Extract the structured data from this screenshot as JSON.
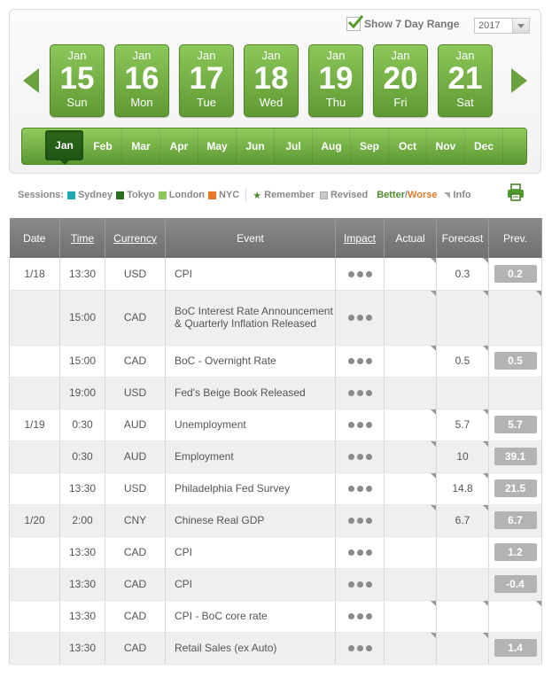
{
  "header": {
    "range_checkbox_label": "Show 7 Day Range",
    "year_value": "2017",
    "days": [
      {
        "month": "Jan",
        "day": "15",
        "weekday": "Sun"
      },
      {
        "month": "Jan",
        "day": "16",
        "weekday": "Mon"
      },
      {
        "month": "Jan",
        "day": "17",
        "weekday": "Tue"
      },
      {
        "month": "Jan",
        "day": "18",
        "weekday": "Wed"
      },
      {
        "month": "Jan",
        "day": "19",
        "weekday": "Thu"
      },
      {
        "month": "Jan",
        "day": "20",
        "weekday": "Fri"
      },
      {
        "month": "Jan",
        "day": "21",
        "weekday": "Sat"
      }
    ],
    "months": [
      "Jan",
      "Feb",
      "Mar",
      "Apr",
      "May",
      "Jun",
      "Jul",
      "Aug",
      "Sep",
      "Oct",
      "Nov",
      "Dec"
    ],
    "active_month": "Jan"
  },
  "legend": {
    "sessions_label": "Sessions:",
    "sessions": [
      {
        "name": "Sydney",
        "color": "#1fa9b0"
      },
      {
        "name": "Tokyo",
        "color": "#2b6e1d"
      },
      {
        "name": "London",
        "color": "#8cc75a"
      },
      {
        "name": "NYC",
        "color": "#e8772a"
      }
    ],
    "remember": "Remember",
    "revised": "Revised",
    "better": "Better",
    "slash": " / ",
    "worse": "Worse",
    "info": "Info"
  },
  "table": {
    "headers": {
      "date": "Date",
      "time": "Time",
      "currency": "Currency",
      "event": "Event",
      "impact": "Impact",
      "actual": "Actual",
      "forecast": "Forecast",
      "prev": "Prev."
    },
    "rows": [
      {
        "date": "1/18",
        "time": "13:30",
        "currency": "USD",
        "event": "CPI",
        "actual": "",
        "forecast": "0.3",
        "prev": "0.2"
      },
      {
        "date": "",
        "time": "15:00",
        "currency": "CAD",
        "event": "BoC Interest Rate Announcement & Quarterly Inflation Released",
        "actual": "",
        "forecast": "",
        "prev": ""
      },
      {
        "date": "",
        "time": "15:00",
        "currency": "CAD",
        "event": "BoC - Overnight Rate",
        "actual": "",
        "forecast": "0.5",
        "prev": "0.5"
      },
      {
        "date": "",
        "time": "19:00",
        "currency": "USD",
        "event": "Fed's Beige Book Released",
        "actual": "",
        "forecast": "",
        "prev": ""
      },
      {
        "date": "1/19",
        "time": "0:30",
        "currency": "AUD",
        "event": "Unemployment",
        "actual": "",
        "forecast": "5.7",
        "prev": "5.7"
      },
      {
        "date": "",
        "time": "0:30",
        "currency": "AUD",
        "event": "Employment",
        "actual": "",
        "forecast": "10",
        "prev": "39.1"
      },
      {
        "date": "",
        "time": "13:30",
        "currency": "USD",
        "event": "Philadelphia Fed Survey",
        "actual": "",
        "forecast": "14.8",
        "prev": "21.5"
      },
      {
        "date": "1/20",
        "time": "2:00",
        "currency": "CNY",
        "event": "Chinese Real GDP",
        "actual": "",
        "forecast": "6.7",
        "prev": "6.7"
      },
      {
        "date": "",
        "time": "13:30",
        "currency": "CAD",
        "event": "CPI",
        "actual": "",
        "forecast": "",
        "prev": "1.2"
      },
      {
        "date": "",
        "time": "13:30",
        "currency": "CAD",
        "event": "CPI",
        "actual": "",
        "forecast": "",
        "prev": "-0.4"
      },
      {
        "date": "",
        "time": "13:30",
        "currency": "CAD",
        "event": "CPI - BoC core rate",
        "actual": "",
        "forecast": "",
        "prev": ""
      },
      {
        "date": "",
        "time": "13:30",
        "currency": "CAD",
        "event": "Retail Sales (ex Auto)",
        "actual": "",
        "forecast": "",
        "prev": "1.4"
      }
    ]
  }
}
